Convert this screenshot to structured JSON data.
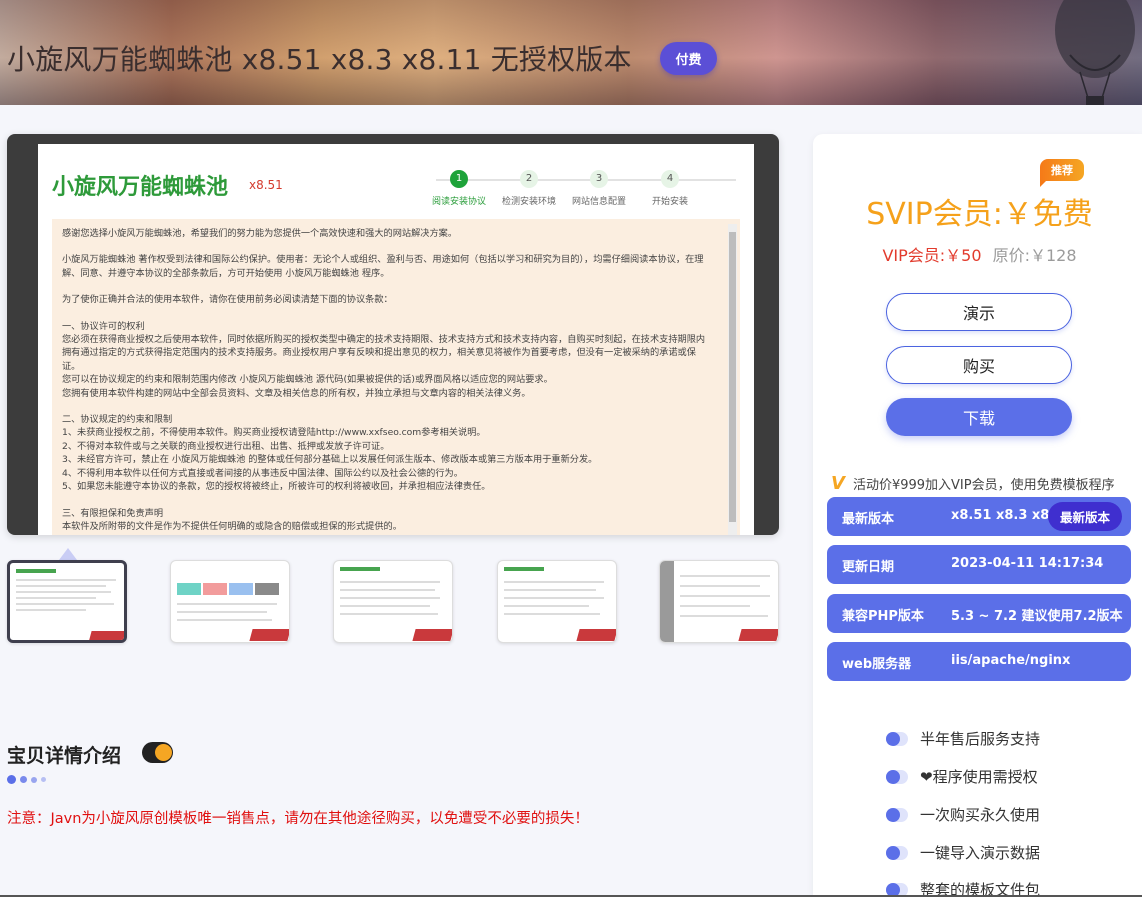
{
  "header": {
    "title": "小旋风万能蜘蛛池 x8.51 x8.3 x8.11 无授权版本",
    "paid_badge": "付费"
  },
  "preview": {
    "app_title": "小旋风万能蜘蛛池",
    "app_version": "x8.51",
    "steps": [
      {
        "num": "1",
        "label": "阅读安装协议"
      },
      {
        "num": "2",
        "label": "检测安装环境"
      },
      {
        "num": "3",
        "label": "网站信息配置"
      },
      {
        "num": "4",
        "label": "开始安装"
      }
    ],
    "agreement": [
      "感谢您选择小旋风万能蜘蛛池，希望我们的努力能为您提供一个高效快速和强大的网站解决方案。",
      "小旋风万能蜘蛛池 著作权受到法律和国际公约保护。使用者：无论个人或组织、盈利与否、用途如何（包括以学习和研究为目的），均需仔细阅读本协议，在理解、同意、并遵守本协议的全部条款后，方可开始使用 小旋风万能蜘蛛池 程序。",
      "为了使你正确并合法的使用本软件，请你在使用前务必阅读清楚下面的协议条款：",
      "一、协议许可的权利\n您必须在获得商业授权之后使用本软件，同时依据所购买的授权类型中确定的技术支持期限、技术支持方式和技术支持内容，自购买时刻起，在技术支持期限内拥有通过指定的方式获得指定范围内的技术支持服务。商业授权用户享有反映和提出意见的权力，相关意见将被作为首要考虑，但没有一定被采纳的承诺或保证。\n您可以在协议规定的约束和限制范围内修改 小旋风万能蜘蛛池 源代码(如果被提供的话)或界面风格以适应您的网站要求。\n您拥有使用本软件构建的网站中全部会员资料、文章及相关信息的所有权，并独立承担与文章内容的相关法律义务。",
      "二、协议规定的约束和限制\n1、未获商业授权之前，不得使用本软件。购买商业授权请登陆http://www.xxfseo.com参考相关说明。\n2、不得对本软件或与之关联的商业授权进行出租、出售、抵押或发放子许可证。\n3、未经官方许可，禁止在 小旋风万能蜘蛛池 的整体或任何部分基础上以发展任何派生版本、修改版本或第三方版本用于重新分发。\n4、不得利用本软件以任何方式直接或者间接的从事违反中国法律、国际公约以及社会公德的行为。\n5、如果您未能遵守本协议的条款，您的授权将被终止，所被许可的权利将被收回，并承担相应法律责任。",
      "三、有限担保和免责声明\n本软件及所附带的文件是作为不提供任何明确的或隐含的赔偿或担保的形式提供的。"
    ]
  },
  "sidebar": {
    "recommend_badge": "推荐",
    "svip_price": "SVIP会员:￥免费",
    "vip_price": "VIP会员:￥50",
    "original_price": "原价:￥128",
    "demo_button": "演示",
    "buy_button": "购买",
    "download_button": "下载",
    "promo_icon": "V",
    "promo_text": "活动价¥999加入VIP会员，使用免费模板程序",
    "info": [
      {
        "key": "最新版本",
        "value": "x8.51 x8.3 x8"
      },
      {
        "key": "更新日期",
        "value": "2023-04-11 14:17:34"
      },
      {
        "key": "兼容PHP版本",
        "value": "5.3 ~ 7.2 建议使用7.2版本"
      },
      {
        "key": "web服务器",
        "value": "iis/apache/nginx"
      }
    ],
    "latest_version_button": "最新版本",
    "features": [
      "半年售后服务支持",
      "❤程序使用需授权",
      "一次购买永久使用",
      "一键导入演示数据",
      "整套的模板文件包"
    ]
  },
  "details": {
    "title": "宝贝详情介绍",
    "notice": "注意：Javn为小旋风原创模板唯一销售点，请勿在其他途径购买，以免遭受不必要的损失！"
  },
  "colors": {
    "accent": "#5b6fe8",
    "svip": "#f5a11b",
    "vip": "#e23b2d",
    "notice": "#e01010",
    "badge": "#5b4fd6"
  }
}
